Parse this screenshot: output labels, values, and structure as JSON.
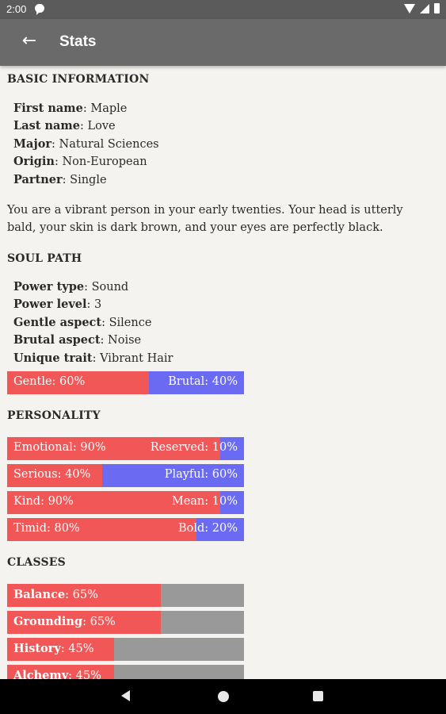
{
  "status_bar": {
    "time": "2:00",
    "icons": [
      "message-icon",
      "wifi-icon",
      "signal-icon",
      "battery-icon"
    ]
  },
  "app_bar": {
    "title": "Stats",
    "back_icon": "arrow-left-icon"
  },
  "basic_information": {
    "title": "BASIC INFORMATION",
    "fields": [
      {
        "label": "First name",
        "value": ": Maple"
      },
      {
        "label": "Last name",
        "value": ": Love"
      },
      {
        "label": "Major",
        "value": ": Natural Sciences"
      },
      {
        "label": "Origin",
        "value": ": Non-European"
      },
      {
        "label": "Partner",
        "value": ": Single"
      }
    ],
    "description": "You are a vibrant person in your early twenties. Your head is utterly bald, your skin is dark brown, and your eyes are perfectly black."
  },
  "soul_path": {
    "title": "SOUL PATH",
    "fields": [
      {
        "label": "Power type",
        "value": ": Sound"
      },
      {
        "label": "Power level",
        "value": ": 3"
      },
      {
        "label": "Gentle aspect",
        "value": ": Silence"
      },
      {
        "label": "Brutal aspect",
        "value": ": Noise"
      },
      {
        "label": "Unique trait",
        "value": ": Vibrant Hair"
      }
    ],
    "bar": {
      "left_label": "Gentle: 60%",
      "right_label": "Brutal: 40%",
      "left_fraction": 0.6
    }
  },
  "personality": {
    "title": "PERSONALITY",
    "bars": [
      {
        "left_label": "Emotional: 90%",
        "right_label": "Reserved: 10%",
        "left_fraction": 0.9
      },
      {
        "left_label": "Serious: 40%",
        "right_label": "Playful: 60%",
        "left_fraction": 0.4
      },
      {
        "left_label": "Kind: 90%",
        "right_label": "Mean: 10%",
        "left_fraction": 0.9
      },
      {
        "left_label": "Timid: 80%",
        "right_label": "Bold: 20%",
        "left_fraction": 0.8
      }
    ]
  },
  "classes": {
    "title": "CLASSES",
    "bars": [
      {
        "name": "Balance",
        "value": ": 65%",
        "fraction": 0.65
      },
      {
        "name": "Grounding",
        "value": ": 65%",
        "fraction": 0.65
      },
      {
        "name": "History",
        "value": ": 45%",
        "fraction": 0.45
      },
      {
        "name": "Alchemy",
        "value": ": 45%",
        "fraction": 0.45
      }
    ]
  },
  "colors": {
    "primary": "#f25757",
    "secondary": "#6a6af2",
    "empty": "#999999",
    "app_bar": "#6a6a6a",
    "background": "#f5f3ef"
  },
  "nav_bar": {
    "icons": [
      "nav-back-icon",
      "nav-home-icon",
      "nav-recents-icon"
    ]
  }
}
